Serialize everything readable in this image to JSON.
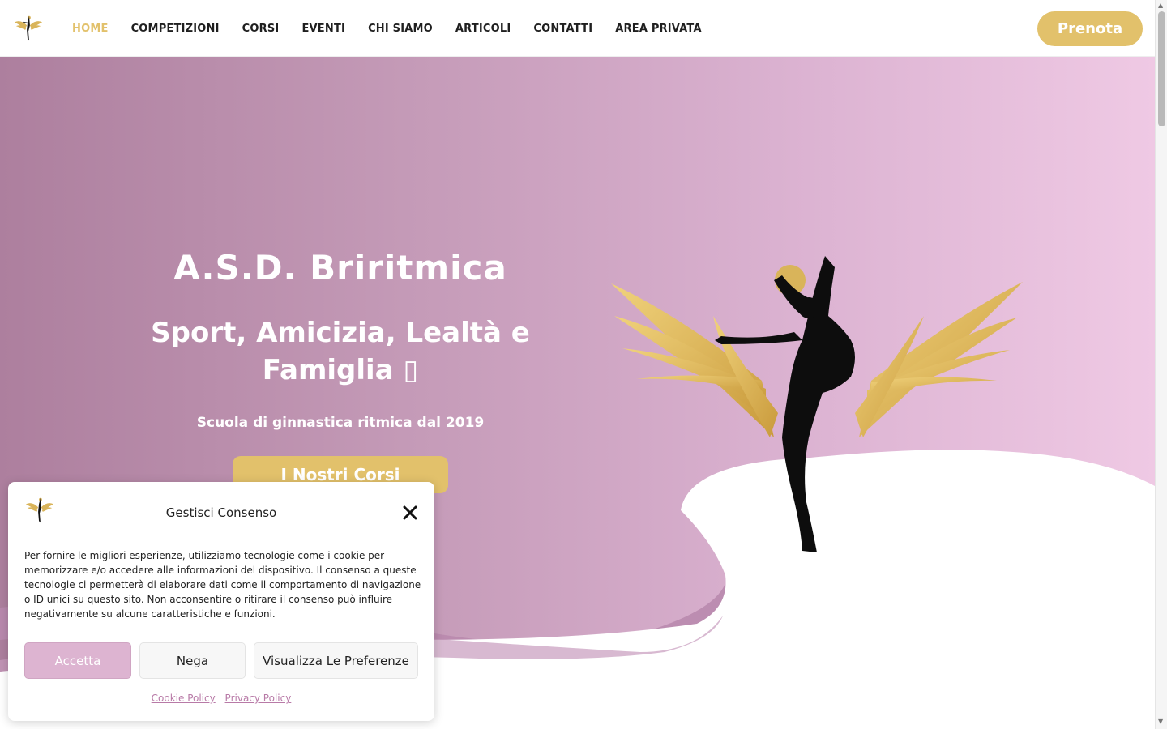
{
  "header": {
    "nav": [
      {
        "label": "HOME",
        "active": true
      },
      {
        "label": "COMPETIZIONI",
        "active": false
      },
      {
        "label": "CORSI",
        "active": false
      },
      {
        "label": "EVENTI",
        "active": false
      },
      {
        "label": "CHI SIAMO",
        "active": false
      },
      {
        "label": "ARTICOLI",
        "active": false
      },
      {
        "label": "CONTATTI",
        "active": false
      },
      {
        "label": "AREA PRIVATA",
        "active": false
      }
    ],
    "cta_label": "Prenota",
    "logo_icon": "winged-gymnast-logo-icon"
  },
  "hero": {
    "title": "A.S.D. Briritmica",
    "subtitle": "Sport, Amicizia, Lealtà e Famiglia ▯",
    "tagline": "Scuola di ginnastica ritmica dal 2019",
    "button_label": "I Nostri Corsi",
    "illustration_icon": "gymnast-with-wings-illustration"
  },
  "cookie_banner": {
    "title": "Gestisci Consenso",
    "text": "Per fornire le migliori esperienze, utilizziamo tecnologie come i cookie per memorizzare e/o accedere alle informazioni del dispositivo. Il consenso a queste tecnologie ci permetterà di elaborare dati come il comportamento di navigazione o ID unici su questo sito. Non acconsentire o ritirare il consenso può influire negativamente su alcune caratteristiche e funzioni.",
    "accept_label": "Accetta",
    "deny_label": "Nega",
    "preferences_label": "Visualizza Le Preferenze",
    "links": [
      "Cookie Policy",
      "Privacy Policy"
    ]
  },
  "colors": {
    "accent_gold": "#e2c16b",
    "hero_pink_dark": "#ad7f9e",
    "hero_pink_light": "#efc9e4",
    "accept_pink": "#ddb4d1",
    "link_pink": "#b87aa7"
  }
}
